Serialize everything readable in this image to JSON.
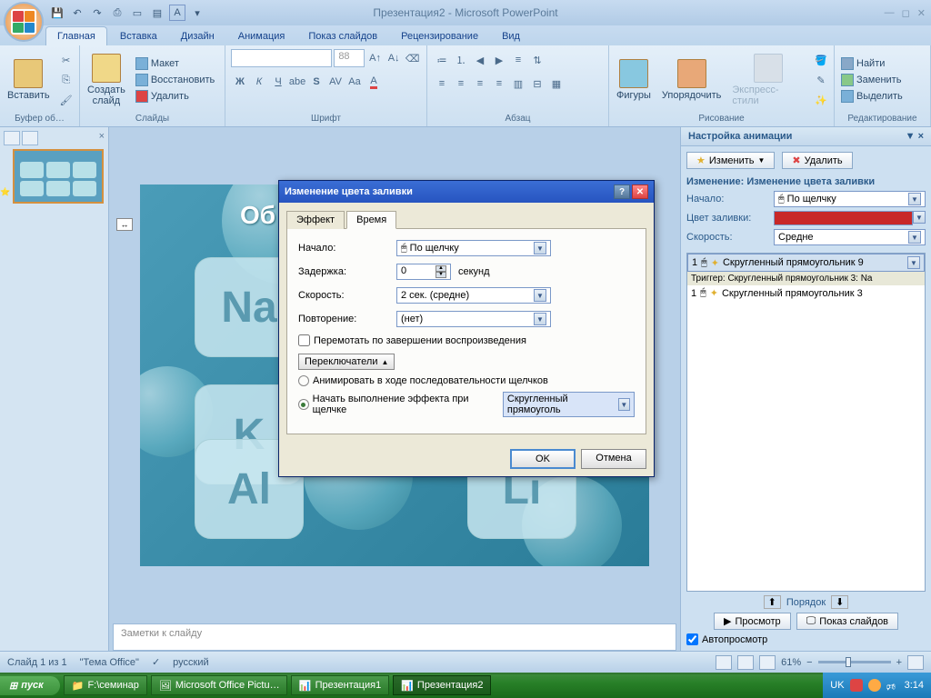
{
  "title": "Презентация2 - Microsoft PowerPoint",
  "qat": [
    "save",
    "undo",
    "redo",
    "quickprint",
    "new",
    "open"
  ],
  "tabs": [
    "Главная",
    "Вставка",
    "Дизайн",
    "Анимация",
    "Показ слайдов",
    "Рецензирование",
    "Вид"
  ],
  "active_tab": 0,
  "ribbon": {
    "clipboard": {
      "paste": "Вставить",
      "label": "Буфер об…"
    },
    "slides": {
      "new": "Создать\nслайд",
      "layout": "Макет",
      "reset": "Восстановить",
      "delete": "Удалить",
      "label": "Слайды"
    },
    "font": {
      "label": "Шрифт",
      "size": "88"
    },
    "paragraph": {
      "label": "Абзац"
    },
    "drawing": {
      "shapes": "Фигуры",
      "arrange": "Упорядочить",
      "styles": "Экспресс-стили",
      "label": "Рисование"
    },
    "editing": {
      "find": "Найти",
      "replace": "Заменить",
      "select": "Выделить",
      "label": "Редактирование"
    }
  },
  "slide_tiles": [
    "Na",
    "",
    "",
    "K",
    "",
    "",
    "Al",
    "",
    "Li"
  ],
  "notes_placeholder": "Заметки к слайду",
  "anim_pane": {
    "header": "Настройка анимации",
    "change": "Изменить",
    "remove": "Удалить",
    "change_line": "Изменение: Изменение цвета заливки",
    "start_label": "Начало:",
    "start_value": "По щелчку",
    "fill_label": "Цвет заливки:",
    "speed_label": "Скорость:",
    "speed_value": "Средне",
    "item1": "Скругленный прямоугольник 9",
    "trigger": "Триггер: Скругленный прямоугольник 3: Na",
    "item2": "Скругленный прямоугольник 3",
    "reorder": "Порядок",
    "preview": "Просмотр",
    "slideshow": "Показ слайдов",
    "autopreview": "Автопросмотр"
  },
  "dialog": {
    "title": "Изменение цвета заливки",
    "tab_effect": "Эффект",
    "tab_timing": "Время",
    "start_label": "Начало:",
    "start_value": "По щелчку",
    "delay_label": "Задержка:",
    "delay_value": "0",
    "delay_unit": "секунд",
    "speed_label": "Скорость:",
    "speed_value": "2 сек. (средне)",
    "repeat_label": "Повторение:",
    "repeat_value": "(нет)",
    "rewind": "Перемотать по завершении воспроизведения",
    "triggers": "Переключатели",
    "radio1": "Анимировать в ходе последовательности щелчков",
    "radio2": "Начать выполнение эффекта при щелчке",
    "trigger_object": "Скругленный прямоуголь",
    "ok": "OK",
    "cancel": "Отмена"
  },
  "status": {
    "slide": "Слайд 1 из 1",
    "theme": "\"Тема Office\"",
    "lang": "русский",
    "zoom": "61%"
  },
  "taskbar": {
    "start": "пуск",
    "items": [
      "F:\\семинар",
      "Microsoft Office Pictu…",
      "Презентация1",
      "Презентация2"
    ],
    "lang": "UK",
    "time": "3:14"
  }
}
